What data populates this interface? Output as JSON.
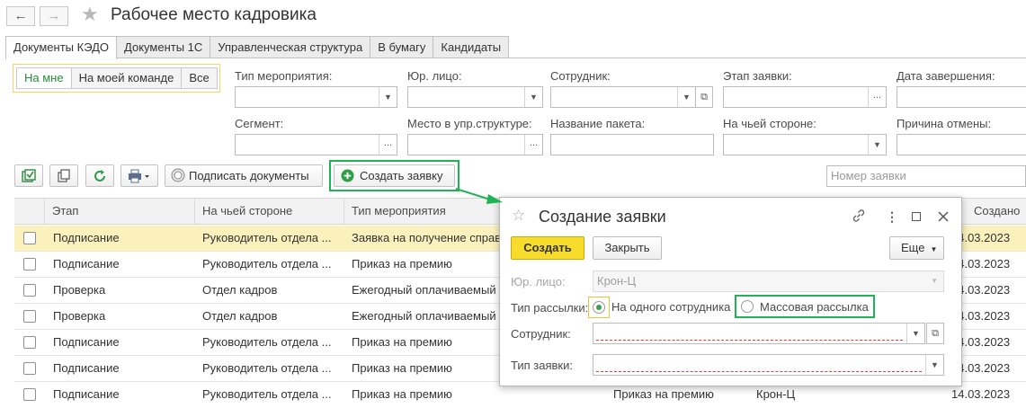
{
  "header": {
    "title": "Рабочее место кадровика",
    "back_icon": "←",
    "forward_icon": "→",
    "favorite_icon": "★"
  },
  "tabs": [
    {
      "label": "Документы КЭДО"
    },
    {
      "label": "Документы 1С"
    },
    {
      "label": "Управленческая структура"
    },
    {
      "label": "В бумагу"
    },
    {
      "label": "Кандидаты"
    }
  ],
  "segment": {
    "items": [
      {
        "label": "На мне"
      },
      {
        "label": "На моей команде"
      },
      {
        "label": "Все"
      }
    ]
  },
  "filters": {
    "event_type": "Тип мероприятия:",
    "legal_entity": "Юр. лицо:",
    "employee": "Сотрудник:",
    "request_stage": "Этап заявки:",
    "end_date": "Дата завершения:",
    "segment": "Сегмент:",
    "place_in_structure": "Место в упр.структуре:",
    "package_name": "Название пакета:",
    "whose_side": "На чьей стороне:",
    "cancel_reason": "Причина отмены:"
  },
  "toolbar": {
    "sign_documents": "Подписать документы",
    "create_request": "Создать заявку",
    "search_placeholder": "Номер заявки"
  },
  "table": {
    "columns": [
      "Этап",
      "На чьей стороне",
      "Тип мероприятия",
      "Создано"
    ],
    "rows": [
      {
        "stage": "Подписание",
        "side": "Руководитель отдела ...",
        "event": "Заявка на получение справ",
        "date": "14.03.2023",
        "extra1": "",
        "extra2": ""
      },
      {
        "stage": "Подписание",
        "side": "Руководитель отдела ...",
        "event": "Приказ на премию",
        "date": "14.03.2023",
        "extra1": "",
        "extra2": ""
      },
      {
        "stage": "Проверка",
        "side": "Отдел кадров",
        "event": "Ежегодный оплачиваемый",
        "date": "14.03.2023",
        "extra1": "",
        "extra2": ""
      },
      {
        "stage": "Проверка",
        "side": "Отдел кадров",
        "event": "Ежегодный оплачиваемый",
        "date": "14.03.2023",
        "extra1": "",
        "extra2": ""
      },
      {
        "stage": "Подписание",
        "side": "Руководитель отдела ...",
        "event": "Приказ на премию",
        "date": "14.03.2023",
        "extra1": "",
        "extra2": ""
      },
      {
        "stage": "Подписание",
        "side": "Руководитель отдела ...",
        "event": "Приказ на премию",
        "date": "14.03.2023",
        "extra1": "",
        "extra2": ""
      },
      {
        "stage": "Подписание",
        "side": "Руководитель отдела ...",
        "event": "Приказ на премию",
        "date": "14.03.2023",
        "extra1": "Приказ на премию",
        "extra2": "Крон-Ц"
      }
    ]
  },
  "dialog": {
    "title": "Создание заявки",
    "create": "Создать",
    "close": "Закрыть",
    "more": "Еще",
    "legal_entity_label": "Юр. лицо:",
    "legal_entity_value": "Крон-Ц",
    "mailing_type_label": "Тип рассылки:",
    "option_single": "На одного сотрудника",
    "option_mass": "Массовая рассылка",
    "employee_label": "Сотрудник:",
    "request_type_label": "Тип заявки:"
  },
  "colors": {
    "accent_green": "#1fb356",
    "primary_yellow": "#f8dc2b",
    "selected_row": "#fbf1bd"
  }
}
